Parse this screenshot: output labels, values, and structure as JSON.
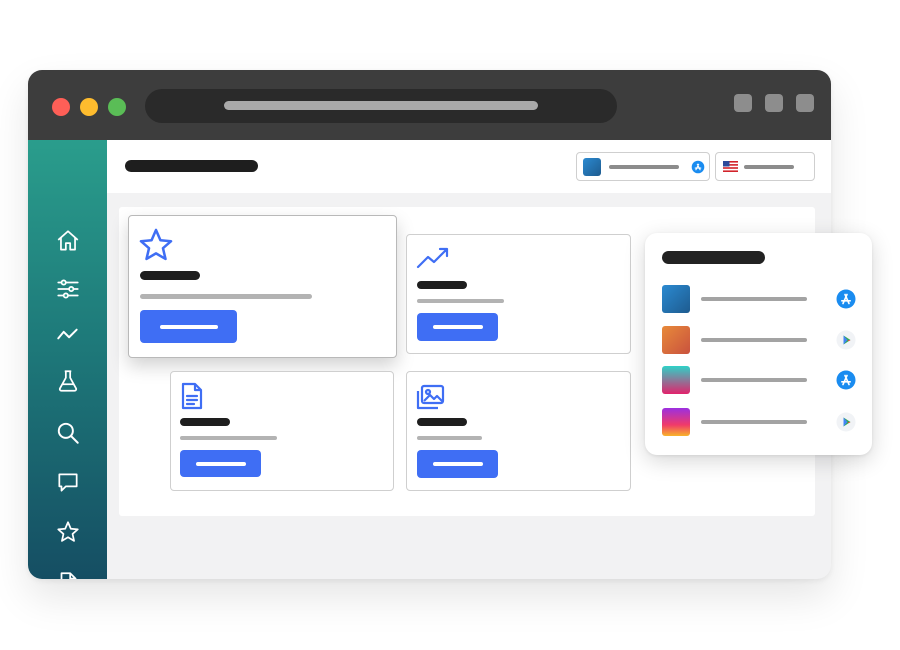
{
  "window": {
    "traffic_lights": [
      "close",
      "minimize",
      "zoom"
    ],
    "colors": {
      "titlebar": "#3d3d3d",
      "accent": "#3f6ef4",
      "sidebar_top": "#2a9d8c",
      "sidebar_bottom": "#154e63"
    }
  },
  "sidebar": {
    "items": [
      {
        "icon": "home-icon"
      },
      {
        "icon": "sliders-icon"
      },
      {
        "icon": "trend-line-icon"
      },
      {
        "icon": "flask-icon"
      },
      {
        "icon": "search-icon"
      },
      {
        "icon": "chat-icon"
      },
      {
        "icon": "star-icon"
      },
      {
        "icon": "document-icon"
      }
    ]
  },
  "header": {
    "app_selector": {
      "store": "app-store-icon"
    },
    "language_selector": {
      "flag": "us-flag-icon"
    }
  },
  "cards": [
    {
      "icon": "star-icon",
      "featured": true
    },
    {
      "icon": "trending-up-icon",
      "featured": false
    },
    {
      "icon": "document-icon",
      "featured": false
    },
    {
      "icon": "image-icon",
      "featured": false
    }
  ],
  "app_list": {
    "items": [
      {
        "store": "app-store-icon",
        "color_from": "#2b8ad1",
        "color_to": "#1e5b8f"
      },
      {
        "store": "google-play-icon",
        "color_from": "#e88a3a",
        "color_to": "#c9523e"
      },
      {
        "store": "app-store-icon",
        "color_from": "#2fd1c7",
        "color_to": "#e2236c"
      },
      {
        "store": "google-play-icon",
        "color_from": "#9b2fe0",
        "color_to": "#f8b42a"
      }
    ]
  }
}
